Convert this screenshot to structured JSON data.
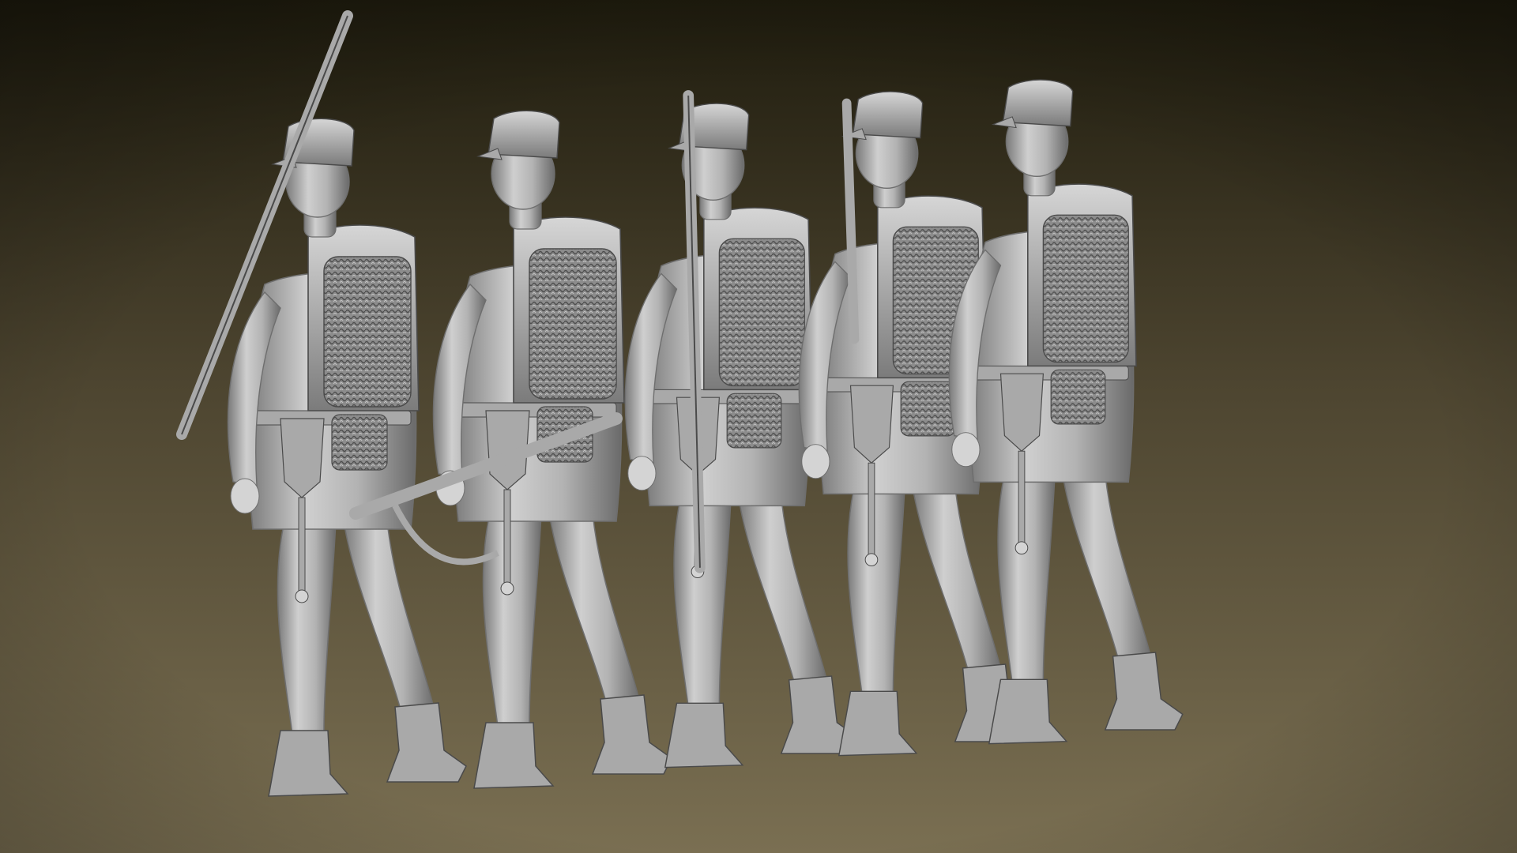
{
  "scene": {
    "figure_count": 5,
    "colors": {
      "background_top": "#1f1c0e",
      "background_bottom": "#7a6f52",
      "sculpt_light": "#d4d4d4",
      "sculpt_mid": "#a9a9a9",
      "sculpt_dark": "#6e6e6e",
      "sculpt_deep": "#4a4a4a"
    }
  }
}
